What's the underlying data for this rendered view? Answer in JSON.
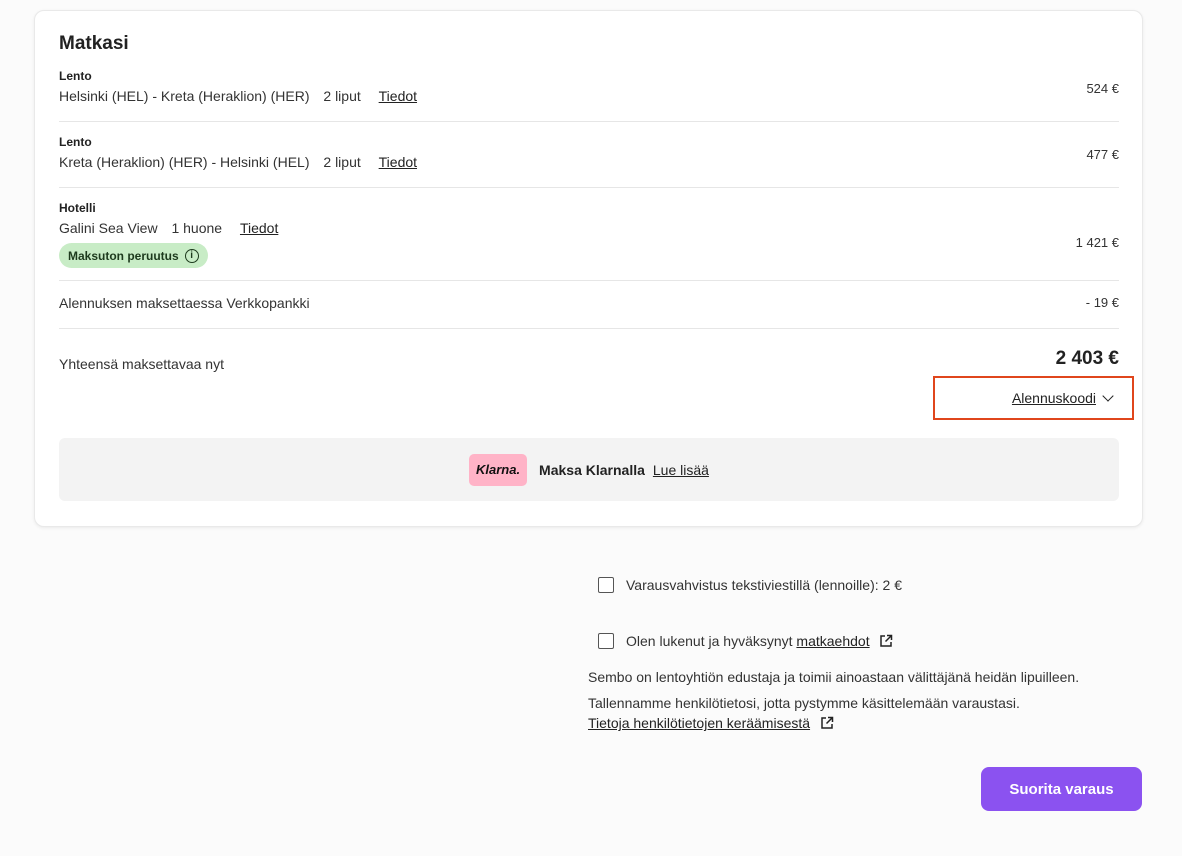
{
  "summary": {
    "title": "Matkasi",
    "items": [
      {
        "kind": "Lento",
        "route": "Helsinki (HEL) - Kreta (Heraklion) (HER)",
        "qty": "2 liput",
        "details_link": "Tiedot",
        "price": "524 €"
      },
      {
        "kind": "Lento",
        "route": "Kreta (Heraklion) (HER) - Helsinki (HEL)",
        "qty": "2 liput",
        "details_link": "Tiedot",
        "price": "477 €"
      },
      {
        "kind": "Hotelli",
        "route": "Galini Sea View",
        "qty": "1 huone",
        "details_link": "Tiedot",
        "price": "1 421 €",
        "badge": "Maksuton peruutus"
      }
    ],
    "discount": {
      "label": "Alennuksen maksettaessa Verkkopankki",
      "value": "- 19 €"
    },
    "total": {
      "label": "Yhteensä maksettavaa nyt",
      "value": "2 403 €"
    },
    "coupon_label": "Alennuskoodi",
    "klarna": {
      "logo": "Klarna.",
      "text": "Maksa Klarnalla",
      "link": "Lue lisää"
    }
  },
  "options": {
    "sms": "Varausvahvistus tekstiviestillä (lennoille): 2 €",
    "terms_prefix": "Olen lukenut ja hyväksynyt",
    "terms_link": "matkaehdot"
  },
  "notes": {
    "agent": "Sembo on lentoyhtiön edustaja ja toimii ainoastaan välittäjänä heidän lipuilleen.",
    "privacy": "Tallennamme henkilötietosi, jotta pystymme käsittelemään varaustasi.",
    "privacy_link": "Tietoja henkilötietojen keräämisestä"
  },
  "submit_label": "Suorita varaus",
  "colors": {
    "accent": "#8b52f0",
    "highlight": "#e0461c",
    "badge": "#c8ecc6",
    "klarna": "#ffb3c7"
  }
}
